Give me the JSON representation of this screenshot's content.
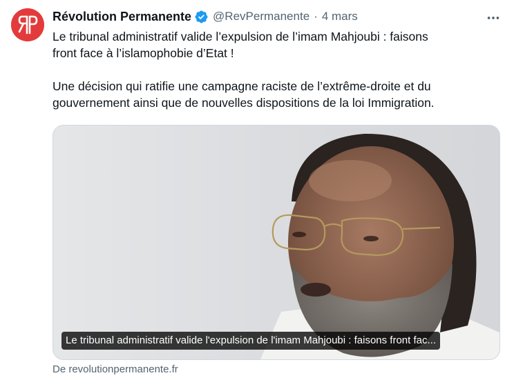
{
  "author": {
    "name": "Révolution Permanente",
    "handle": "@RevPermanente",
    "separator": "·",
    "time": "4 mars",
    "verified": true,
    "avatar_icon": "rp-logo-icon",
    "avatar_color": "#e33b3b"
  },
  "tweet": {
    "paragraph_1_line_1": "Le tribunal administratif valide l’expulsion de l’imam Mahjoubi : faisons",
    "paragraph_1_line_2": "front face à l’islamophobie d’Etat !",
    "paragraph_2_line_1": "Une décision qui ratifie une campagne raciste de l’extrême-droite et du",
    "paragraph_2_line_2": "gouvernement ainsi que de nouvelles dispositions de la loi Immigration."
  },
  "card": {
    "caption": "Le tribunal administratif valide l'expulsion de l'imam Mahjoubi : faisons front fac...",
    "source": "De revolutionpermanente.fr"
  },
  "icons": {
    "more": "more-options-icon",
    "verified": "verified-badge-icon"
  },
  "colors": {
    "verified": "#1d9bf0",
    "secondary_text": "#536471",
    "primary_text": "#0f1419"
  }
}
